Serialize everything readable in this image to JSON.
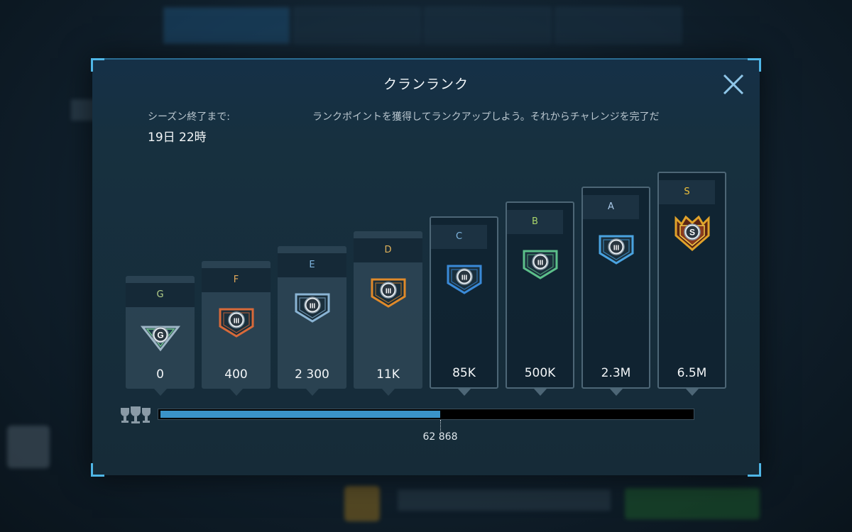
{
  "dialog": {
    "title": "クランランク",
    "season_label": "シーズン終了まで:",
    "season_value": "19日 22時",
    "description": "ランクポイントを獲得してランクアップしよう。それからチャレンジを完了だ"
  },
  "ranks": [
    {
      "letter": "G",
      "points": "0",
      "letter_color": "#b5d08a",
      "badge": "G",
      "badge_color": "#9fb7c6",
      "locked": false
    },
    {
      "letter": "F",
      "points": "400",
      "letter_color": "#e0a85a",
      "badge": "III",
      "badge_color": "#d86a3a",
      "locked": false
    },
    {
      "letter": "E",
      "points": "2 300",
      "letter_color": "#7fb6e0",
      "badge": "III",
      "badge_color": "#8ab4d4",
      "locked": false
    },
    {
      "letter": "D",
      "points": "11K",
      "letter_color": "#e0b25a",
      "badge": "III",
      "badge_color": "#e08a2a",
      "locked": false
    },
    {
      "letter": "C",
      "points": "85K",
      "letter_color": "#7fb6e0",
      "badge": "III",
      "badge_color": "#3a8ad8",
      "locked": true
    },
    {
      "letter": "B",
      "points": "500K",
      "letter_color": "#a8d46a",
      "badge": "III",
      "badge_color": "#5cbf8a",
      "locked": true
    },
    {
      "letter": "A",
      "points": "2.3M",
      "letter_color": "#a9c9e8",
      "badge": "III",
      "badge_color": "#4aa3e0",
      "locked": true
    },
    {
      "letter": "S",
      "points": "6.5M",
      "letter_color": "#f0c23a",
      "badge": "S",
      "badge_color": "#e0a22a",
      "locked": true
    }
  ],
  "progress": {
    "value_label": "62 868",
    "fill_fraction": 0.525
  },
  "colors": {
    "accent": "#3a93c9",
    "corner": "#4fb6e6"
  }
}
